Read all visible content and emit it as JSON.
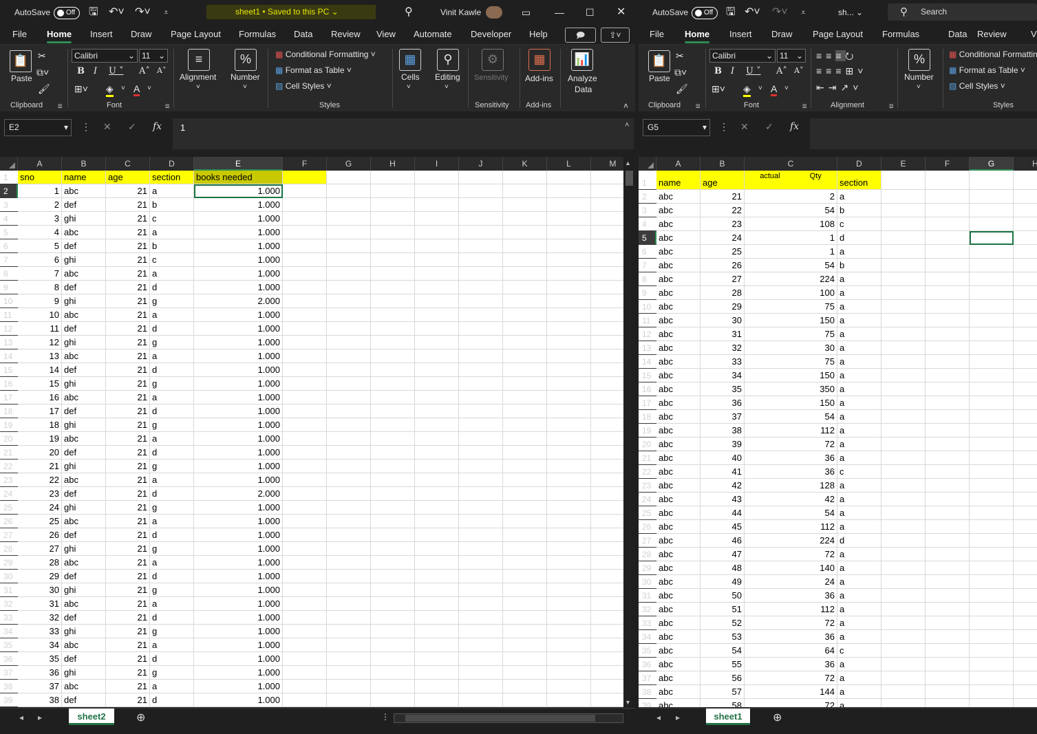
{
  "left": {
    "autosave_label": "AutoSave",
    "toggle_label": "Off",
    "title": "sheet1 • Saved to this PC",
    "user": "Vinit Kawle",
    "menu": [
      "File",
      "Home",
      "Insert",
      "Draw",
      "Page Layout",
      "Formulas",
      "Data",
      "Review",
      "View",
      "Automate",
      "Developer",
      "Help"
    ],
    "ribbon": {
      "paste": "Paste",
      "font_name": "Calibri",
      "font_size": "11",
      "alignment": "Alignment",
      "number": "Number",
      "cond_format": "Conditional Formatting",
      "format_table": "Format as Table",
      "cell_styles": "Cell Styles",
      "cells": "Cells",
      "editing": "Editing",
      "sensitivity": "Sensitivity",
      "addins": "Add-ins",
      "analyze": "Analyze",
      "analyze2": "Data",
      "groups": [
        "Clipboard",
        "Font",
        "Styles",
        "Sensitivity",
        "Add-ins"
      ]
    },
    "name_box": "E2",
    "formula": "1",
    "columns": [
      "A",
      "B",
      "C",
      "D",
      "E",
      "F",
      "G",
      "H",
      "I",
      "J",
      "K",
      "L",
      "M"
    ],
    "header": [
      "sno",
      "name",
      "age",
      "section",
      "books needed"
    ],
    "rows": [
      [
        "1",
        "abc",
        "21",
        "a",
        "1.000"
      ],
      [
        "2",
        "def",
        "21",
        "b",
        "1.000"
      ],
      [
        "3",
        "ghi",
        "21",
        "c",
        "1.000"
      ],
      [
        "4",
        "abc",
        "21",
        "a",
        "1.000"
      ],
      [
        "5",
        "def",
        "21",
        "b",
        "1.000"
      ],
      [
        "6",
        "ghi",
        "21",
        "c",
        "1.000"
      ],
      [
        "7",
        "abc",
        "21",
        "a",
        "1.000"
      ],
      [
        "8",
        "def",
        "21",
        "d",
        "1.000"
      ],
      [
        "9",
        "ghi",
        "21",
        "g",
        "2.000"
      ],
      [
        "10",
        "abc",
        "21",
        "a",
        "1.000"
      ],
      [
        "11",
        "def",
        "21",
        "d",
        "1.000"
      ],
      [
        "12",
        "ghi",
        "21",
        "g",
        "1.000"
      ],
      [
        "13",
        "abc",
        "21",
        "a",
        "1.000"
      ],
      [
        "14",
        "def",
        "21",
        "d",
        "1.000"
      ],
      [
        "15",
        "ghi",
        "21",
        "g",
        "1.000"
      ],
      [
        "16",
        "abc",
        "21",
        "a",
        "1.000"
      ],
      [
        "17",
        "def",
        "21",
        "d",
        "1.000"
      ],
      [
        "18",
        "ghi",
        "21",
        "g",
        "1.000"
      ],
      [
        "19",
        "abc",
        "21",
        "a",
        "1.000"
      ],
      [
        "20",
        "def",
        "21",
        "d",
        "1.000"
      ],
      [
        "21",
        "ghi",
        "21",
        "g",
        "1.000"
      ],
      [
        "22",
        "abc",
        "21",
        "a",
        "1.000"
      ],
      [
        "23",
        "def",
        "21",
        "d",
        "2.000"
      ],
      [
        "24",
        "ghi",
        "21",
        "g",
        "1.000"
      ],
      [
        "25",
        "abc",
        "21",
        "a",
        "1.000"
      ],
      [
        "26",
        "def",
        "21",
        "d",
        "1.000"
      ],
      [
        "27",
        "ghi",
        "21",
        "g",
        "1.000"
      ],
      [
        "28",
        "abc",
        "21",
        "a",
        "1.000"
      ],
      [
        "29",
        "def",
        "21",
        "d",
        "1.000"
      ],
      [
        "30",
        "ghi",
        "21",
        "g",
        "1.000"
      ],
      [
        "31",
        "abc",
        "21",
        "a",
        "1.000"
      ],
      [
        "32",
        "def",
        "21",
        "d",
        "1.000"
      ],
      [
        "33",
        "ghi",
        "21",
        "g",
        "1.000"
      ],
      [
        "34",
        "abc",
        "21",
        "a",
        "1.000"
      ],
      [
        "35",
        "def",
        "21",
        "d",
        "1.000"
      ],
      [
        "36",
        "ghi",
        "21",
        "g",
        "1.000"
      ],
      [
        "37",
        "abc",
        "21",
        "a",
        "1.000"
      ],
      [
        "38",
        "def",
        "21",
        "d",
        "1.000"
      ]
    ],
    "sheet_tab": "sheet2"
  },
  "right": {
    "autosave_label": "AutoSave",
    "toggle_label": "Off",
    "title": "sh...",
    "search": "Search",
    "menu": [
      "File",
      "Home",
      "Insert",
      "Draw",
      "Page Layout",
      "Formulas",
      "Data",
      "Review",
      "View"
    ],
    "ribbon": {
      "paste": "Paste",
      "font_name": "Calibri",
      "font_size": "11",
      "number": "Number",
      "cond_format": "Conditional Formatting",
      "format_table": "Format as Table",
      "cell_styles": "Cell Styles",
      "groups": [
        "Clipboard",
        "Font",
        "Alignment",
        "Styles"
      ]
    },
    "name_box": "G5",
    "formula": "",
    "columns": [
      "A",
      "B",
      "C",
      "D",
      "E",
      "F",
      "G",
      "H"
    ],
    "header": [
      "name",
      "age",
      "actual Qty",
      "section"
    ],
    "rows": [
      [
        "abc",
        "21",
        "2",
        "a"
      ],
      [
        "abc",
        "22",
        "54",
        "b"
      ],
      [
        "abc",
        "23",
        "108",
        "c"
      ],
      [
        "abc",
        "24",
        "1",
        "d"
      ],
      [
        "abc",
        "25",
        "1",
        "a"
      ],
      [
        "abc",
        "26",
        "54",
        "b"
      ],
      [
        "abc",
        "27",
        "224",
        "a"
      ],
      [
        "abc",
        "28",
        "100",
        "a"
      ],
      [
        "abc",
        "29",
        "75",
        "a"
      ],
      [
        "abc",
        "30",
        "150",
        "a"
      ],
      [
        "abc",
        "31",
        "75",
        "a"
      ],
      [
        "abc",
        "32",
        "30",
        "a"
      ],
      [
        "abc",
        "33",
        "75",
        "a"
      ],
      [
        "abc",
        "34",
        "150",
        "a"
      ],
      [
        "abc",
        "35",
        "350",
        "a"
      ],
      [
        "abc",
        "36",
        "150",
        "a"
      ],
      [
        "abc",
        "37",
        "54",
        "a"
      ],
      [
        "abc",
        "38",
        "112",
        "a"
      ],
      [
        "abc",
        "39",
        "72",
        "a"
      ],
      [
        "abc",
        "40",
        "36",
        "a"
      ],
      [
        "abc",
        "41",
        "36",
        "c"
      ],
      [
        "abc",
        "42",
        "128",
        "a"
      ],
      [
        "abc",
        "43",
        "42",
        "a"
      ],
      [
        "abc",
        "44",
        "54",
        "a"
      ],
      [
        "abc",
        "45",
        "112",
        "a"
      ],
      [
        "abc",
        "46",
        "224",
        "d"
      ],
      [
        "abc",
        "47",
        "72",
        "a"
      ],
      [
        "abc",
        "48",
        "140",
        "a"
      ],
      [
        "abc",
        "49",
        "24",
        "a"
      ],
      [
        "abc",
        "50",
        "36",
        "a"
      ],
      [
        "abc",
        "51",
        "112",
        "a"
      ],
      [
        "abc",
        "52",
        "72",
        "a"
      ],
      [
        "abc",
        "53",
        "36",
        "a"
      ],
      [
        "abc",
        "54",
        "64",
        "c"
      ],
      [
        "abc",
        "55",
        "36",
        "a"
      ],
      [
        "abc",
        "56",
        "72",
        "a"
      ],
      [
        "abc",
        "57",
        "144",
        "a"
      ],
      [
        "abc",
        "58",
        "72",
        "a"
      ]
    ],
    "sheet_tab": "sheet1"
  }
}
